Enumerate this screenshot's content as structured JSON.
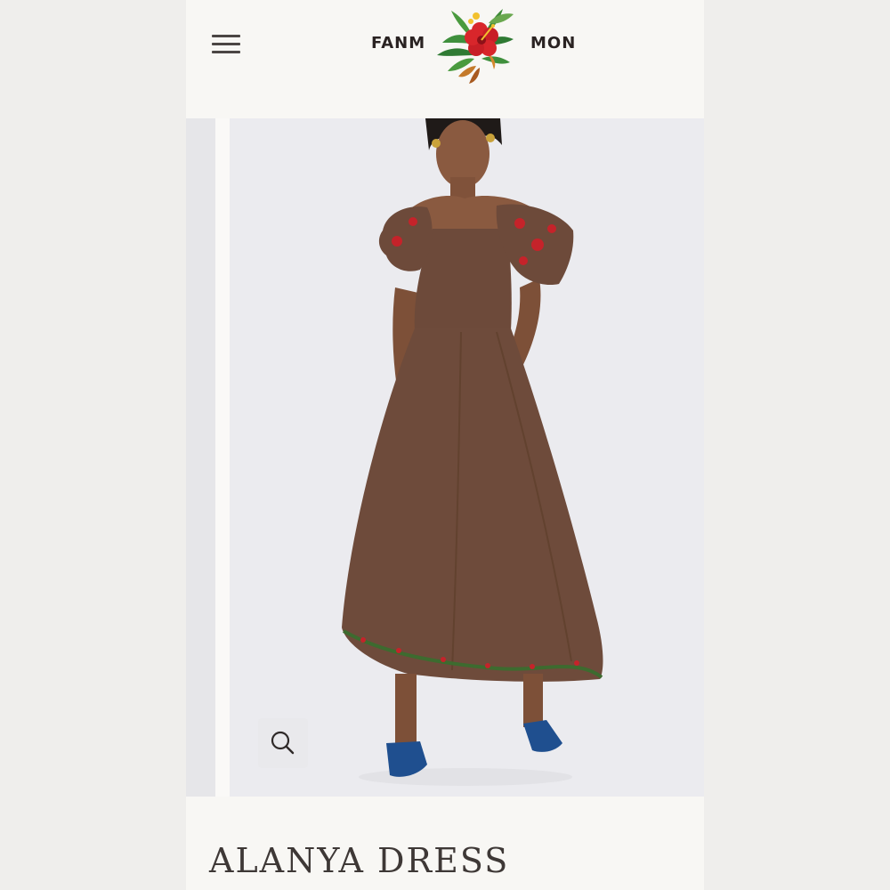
{
  "header": {
    "brand_left": "FANM",
    "brand_right": "MON",
    "menu_icon": "hamburger-menu-icon",
    "logo_icon": "hibiscus-tropical-leaves-icon"
  },
  "gallery": {
    "zoom_icon": "magnifier-icon"
  },
  "product": {
    "title": "ALANYA DRESS"
  },
  "colors": {
    "page_background": "#f8f7f4",
    "photo_background": "#ebebef",
    "dress_brown": "#6d4a3a",
    "embroidery_red": "#c5232a",
    "shoe_blue": "#1f4f8f",
    "title_text": "#3e3836"
  }
}
